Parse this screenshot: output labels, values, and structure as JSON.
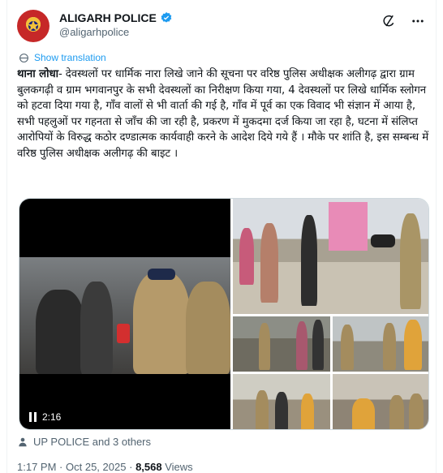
{
  "author": {
    "display_name": "ALIGARH POLICE",
    "handle": "@aligarhpolice",
    "verified_icon": "verified-badge-icon"
  },
  "header_icons": [
    "grok-icon",
    "more-icon"
  ],
  "translate_label": "Show translation",
  "tweet": {
    "lead_bold": "थाना लोधा",
    "body": "- देवस्थलों पर धार्मिक नारा लिखे जाने की सूचना पर वरिष्ठ पुलिस अधीक्षक अलीगढ़ द्वारा ग्राम बुलकगढ़ी व ग्राम भगवानपुर के सभी देवस्थलों का निरीक्षण किया गया, 4 देवस्थलों पर लिखे धार्मिक स्लोगन को हटवा दिया गया है, गाँव वालों से भी वार्ता की गई है, गाँव में पूर्व का एक विवाद भी संज्ञान में आया है, सभी पहलुओं पर गहनता से जाँच की जा रही है, प्रकरण में मुकदमा दर्ज किया जा रहा है, घटना में संलिप्त आरोपियों के विरुद्ध कठोर दण्डात्मक कार्यवाही करने के आदेश दिये गये हैं । मौके पर शांति है, इस सम्बन्ध में वरिष्ठ पुलिस अधीक्षक अलीगढ़ की बाइट ।"
  },
  "media": {
    "video_duration": "2:16",
    "photo_count": 5
  },
  "liked_by": "UP POLICE and 3 others",
  "meta": {
    "time": "1:17 PM",
    "date": "Oct 25, 2025",
    "separator": "·",
    "views_count": "8,568",
    "views_label": "Views"
  }
}
